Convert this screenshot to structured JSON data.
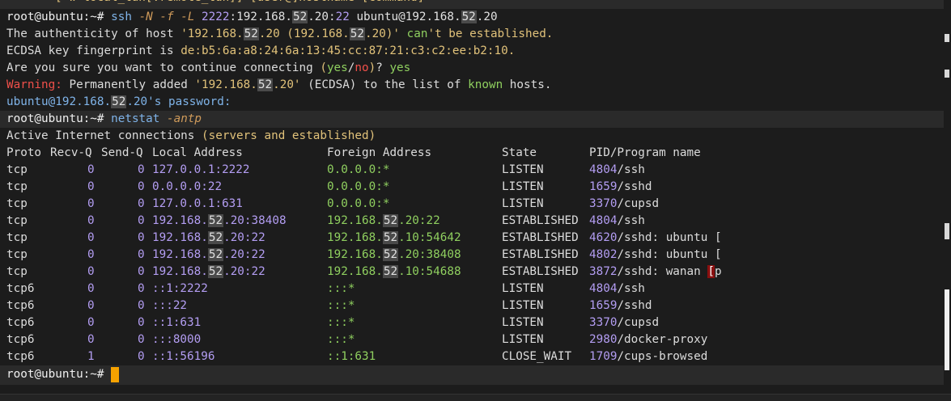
{
  "terminal": {
    "top_fragment": "[-w local_tun[:remote_tun]] [user@]hostname [command]",
    "prompt": "root@ubuntu:~#",
    "ssh_cmd": {
      "program": "ssh",
      "f1": "-N",
      "f2": "-f",
      "f3": "-L",
      "port": "2222",
      "ip_a": "192.168.",
      "ip_b": "52",
      "ip_c": ".20",
      "port2": "22",
      "target_a": "ubuntu@192.168.",
      "target_b": "52",
      "target_c": ".20"
    },
    "auth_line": {
      "a": "The authenticity of host ",
      "b": "'192.168.",
      "c": "52",
      "d": ".20 (192.168.",
      "e": "52",
      "f": ".20)'",
      "g": " can",
      "h": "'t be established."
    },
    "fingerprint_label": "ECDSA key fingerprint is ",
    "fingerprint": "de:b5:6a:a8:24:6a:13:45:cc:87:21:c3:c2:ee:b2:10.",
    "confirm_text": "Are you sure you want to continue connecting ",
    "confirm_yes": "yes",
    "confirm_no": "no",
    "confirm_answer": "yes",
    "warning_label": "Warning:",
    "warning_text": " Permanently added ",
    "warning_ip_a": "'192.168.",
    "warning_ip_b": "52",
    "warning_ip_c": ".20'",
    "warning_mid": " (ECDSA) to the list of ",
    "warning_known": "known",
    "warning_end": " hosts.",
    "password_a": "ubuntu@192.168.",
    "password_b": "52",
    "password_c": ".20's password:",
    "netstat_program": "netstat",
    "netstat_flag": "-antp",
    "active_a": "Active Internet connections ",
    "active_b": "(servers and established)",
    "headers": {
      "proto": "Proto",
      "recvq": "Recv-Q",
      "sendq": "Send-Q",
      "local": "Local Address",
      "foreign": "Foreign Address",
      "state": "State",
      "pid": "PID/Program name"
    },
    "rows": [
      {
        "proto": "tcp",
        "recv": "0",
        "send": "0",
        "local": "127.0.0.1:2222",
        "foreign": "0.0.0.0:*",
        "state": "LISTEN",
        "pid": "4804",
        "prog": "/ssh"
      },
      {
        "proto": "tcp",
        "recv": "0",
        "send": "0",
        "local": "0.0.0.0:22",
        "foreign": "0.0.0.0:*",
        "state": "LISTEN",
        "pid": "1659",
        "prog": "/sshd"
      },
      {
        "proto": "tcp",
        "recv": "0",
        "send": "0",
        "local": "127.0.0.1:631",
        "foreign": "0.0.0.0:*",
        "state": "LISTEN",
        "pid": "3370",
        "prog": "/cupsd"
      },
      {
        "proto": "tcp",
        "recv": "0",
        "send": "0",
        "local": "192.168.52.20:38408",
        "foreign": "192.168.52.20:22",
        "state": "ESTABLISHED",
        "pid": "4804",
        "prog": "/ssh"
      },
      {
        "proto": "tcp",
        "recv": "0",
        "send": "0",
        "local": "192.168.52.20:22",
        "foreign": "192.168.52.10:54642",
        "state": "ESTABLISHED",
        "pid": "4620",
        "prog": "/sshd: ubuntu ["
      },
      {
        "proto": "tcp",
        "recv": "0",
        "send": "0",
        "local": "192.168.52.20:22",
        "foreign": "192.168.52.20:38408",
        "state": "ESTABLISHED",
        "pid": "4802",
        "prog": "/sshd: ubuntu ["
      },
      {
        "proto": "tcp",
        "recv": "0",
        "send": "0",
        "local": "192.168.52.20:22",
        "foreign": "192.168.52.10:54688",
        "state": "ESTABLISHED",
        "pid": "3872",
        "prog": "/sshd: wanan [p"
      },
      {
        "proto": "tcp6",
        "recv": "0",
        "send": "0",
        "local": "::1:2222",
        "foreign": ":::*",
        "state": "LISTEN",
        "pid": "4804",
        "prog": "/ssh"
      },
      {
        "proto": "tcp6",
        "recv": "0",
        "send": "0",
        "local": ":::22",
        "foreign": ":::*",
        "state": "LISTEN",
        "pid": "1659",
        "prog": "/sshd"
      },
      {
        "proto": "tcp6",
        "recv": "0",
        "send": "0",
        "local": "::1:631",
        "foreign": ":::*",
        "state": "LISTEN",
        "pid": "3370",
        "prog": "/cupsd"
      },
      {
        "proto": "tcp6",
        "recv": "0",
        "send": "0",
        "local": ":::8000",
        "foreign": ":::*",
        "state": "LISTEN",
        "pid": "2980",
        "prog": "/docker-proxy"
      },
      {
        "proto": "tcp6",
        "recv": "1",
        "send": "0",
        "local": "::1:56196",
        "foreign": "::1:631",
        "state": "CLOSE_WAIT",
        "pid": "1709",
        "prog": "/cups-browsed"
      }
    ]
  },
  "colors": {
    "background": "#1c1c1c",
    "command": "#7fb3e8",
    "number": "#b39df2",
    "string": "#e1c27a",
    "green": "#8fcf5f",
    "red": "#f0504a",
    "cursor": "#f6a200"
  }
}
